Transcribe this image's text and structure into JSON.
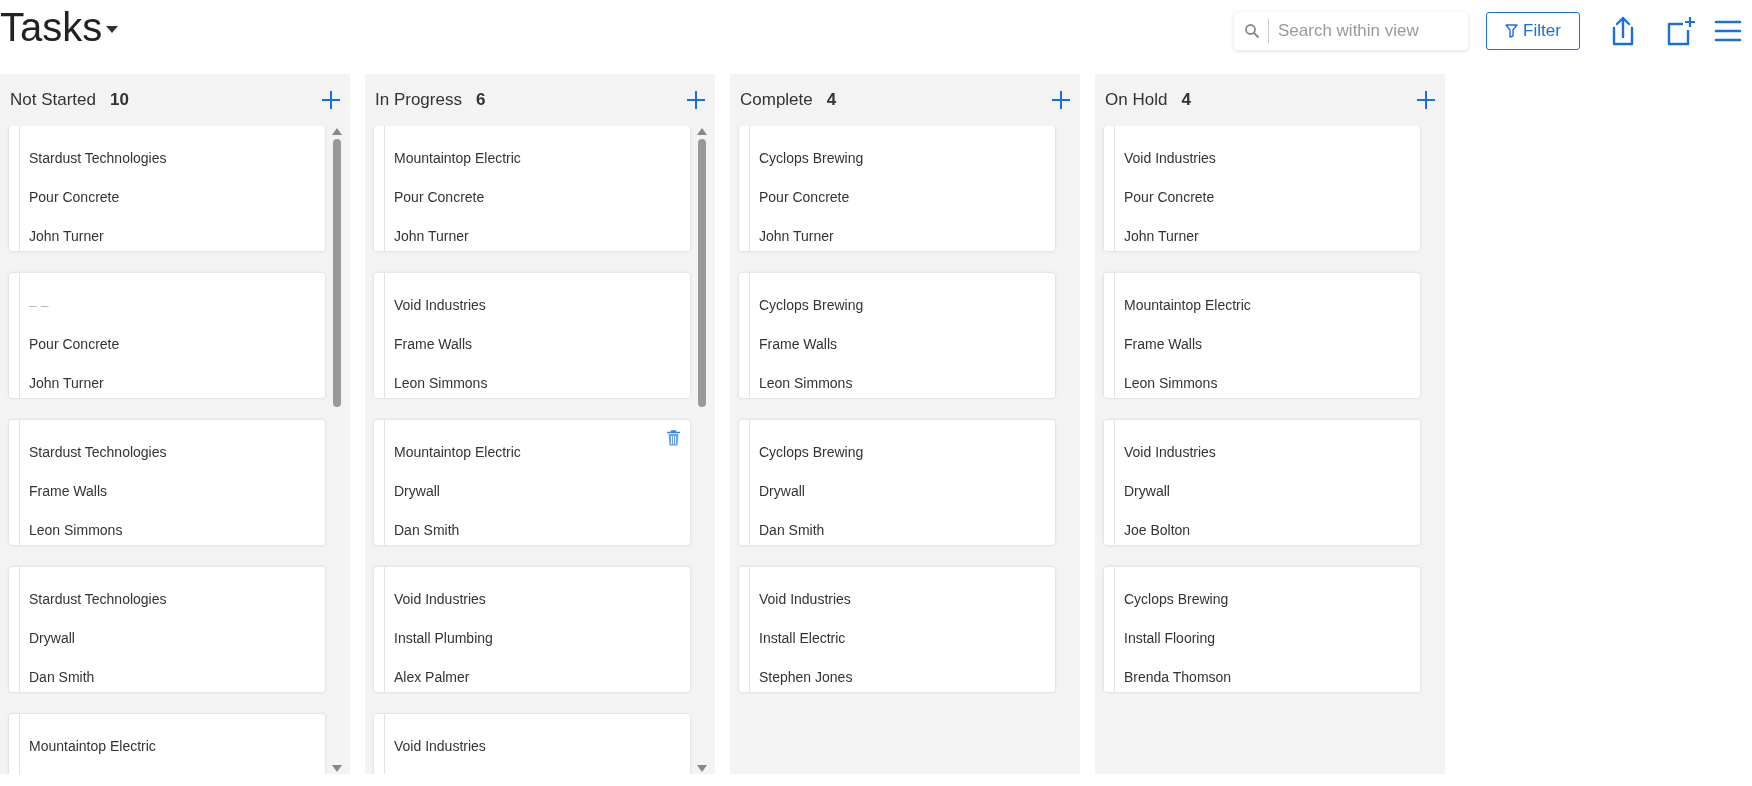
{
  "header": {
    "title": "Tasks",
    "search": {
      "placeholder": "Search within view"
    },
    "filter_button": "Filter"
  },
  "columns": [
    {
      "name": "Not Started",
      "count": "10",
      "scrollable": true,
      "cards": [
        {
          "show_delete": false,
          "lines": [
            {
              "text": "Stardust Technologies",
              "muted": false
            },
            {
              "text": "Pour Concrete",
              "muted": false
            },
            {
              "text": "John Turner",
              "muted": false
            }
          ]
        },
        {
          "show_delete": false,
          "lines": [
            {
              "text": "– –",
              "muted": true
            },
            {
              "text": "Pour Concrete",
              "muted": false
            },
            {
              "text": "John Turner",
              "muted": false
            }
          ]
        },
        {
          "show_delete": false,
          "lines": [
            {
              "text": "Stardust Technologies",
              "muted": false
            },
            {
              "text": "Frame Walls",
              "muted": false
            },
            {
              "text": "Leon Simmons",
              "muted": false
            }
          ]
        },
        {
          "show_delete": false,
          "lines": [
            {
              "text": "Stardust Technologies",
              "muted": false
            },
            {
              "text": "Drywall",
              "muted": false
            },
            {
              "text": "Dan Smith",
              "muted": false
            }
          ]
        },
        {
          "show_delete": false,
          "lines": [
            {
              "text": "Mountaintop Electric",
              "muted": false
            }
          ]
        }
      ]
    },
    {
      "name": "In Progress",
      "count": "6",
      "scrollable": true,
      "cards": [
        {
          "show_delete": false,
          "lines": [
            {
              "text": "Mountaintop Electric",
              "muted": false
            },
            {
              "text": "Pour Concrete",
              "muted": false
            },
            {
              "text": "John Turner",
              "muted": false
            }
          ]
        },
        {
          "show_delete": false,
          "lines": [
            {
              "text": "Void Industries",
              "muted": false
            },
            {
              "text": "Frame Walls",
              "muted": false
            },
            {
              "text": "Leon Simmons",
              "muted": false
            }
          ]
        },
        {
          "show_delete": true,
          "lines": [
            {
              "text": "Mountaintop Electric",
              "muted": false
            },
            {
              "text": "Drywall",
              "muted": false
            },
            {
              "text": "Dan Smith",
              "muted": false
            }
          ]
        },
        {
          "show_delete": false,
          "lines": [
            {
              "text": "Void Industries",
              "muted": false
            },
            {
              "text": "Install Plumbing",
              "muted": false
            },
            {
              "text": "Alex Palmer",
              "muted": false
            }
          ]
        },
        {
          "show_delete": false,
          "lines": [
            {
              "text": "Void Industries",
              "muted": false
            }
          ]
        }
      ]
    },
    {
      "name": "Complete",
      "count": "4",
      "scrollable": false,
      "cards": [
        {
          "show_delete": false,
          "lines": [
            {
              "text": "Cyclops Brewing",
              "muted": false
            },
            {
              "text": "Pour Concrete",
              "muted": false
            },
            {
              "text": "John Turner",
              "muted": false
            }
          ]
        },
        {
          "show_delete": false,
          "lines": [
            {
              "text": "Cyclops Brewing",
              "muted": false
            },
            {
              "text": "Frame Walls",
              "muted": false
            },
            {
              "text": "Leon Simmons",
              "muted": false
            }
          ]
        },
        {
          "show_delete": false,
          "lines": [
            {
              "text": "Cyclops Brewing",
              "muted": false
            },
            {
              "text": "Drywall",
              "muted": false
            },
            {
              "text": "Dan Smith",
              "muted": false
            }
          ]
        },
        {
          "show_delete": false,
          "lines": [
            {
              "text": "Void Industries",
              "muted": false
            },
            {
              "text": "Install Electric",
              "muted": false
            },
            {
              "text": "Stephen Jones",
              "muted": false
            }
          ]
        }
      ]
    },
    {
      "name": "On Hold",
      "count": "4",
      "scrollable": false,
      "cards": [
        {
          "show_delete": false,
          "lines": [
            {
              "text": "Void Industries",
              "muted": false
            },
            {
              "text": "Pour Concrete",
              "muted": false
            },
            {
              "text": "John Turner",
              "muted": false
            }
          ]
        },
        {
          "show_delete": false,
          "lines": [
            {
              "text": "Mountaintop Electric",
              "muted": false
            },
            {
              "text": "Frame Walls",
              "muted": false
            },
            {
              "text": "Leon Simmons",
              "muted": false
            }
          ]
        },
        {
          "show_delete": false,
          "lines": [
            {
              "text": "Void Industries",
              "muted": false
            },
            {
              "text": "Drywall",
              "muted": false
            },
            {
              "text": "Joe Bolton",
              "muted": false
            }
          ]
        },
        {
          "show_delete": false,
          "lines": [
            {
              "text": "Cyclops Brewing",
              "muted": false
            },
            {
              "text": "Install Flooring",
              "muted": false
            },
            {
              "text": "Brenda Thomson",
              "muted": false
            }
          ]
        }
      ]
    }
  ]
}
